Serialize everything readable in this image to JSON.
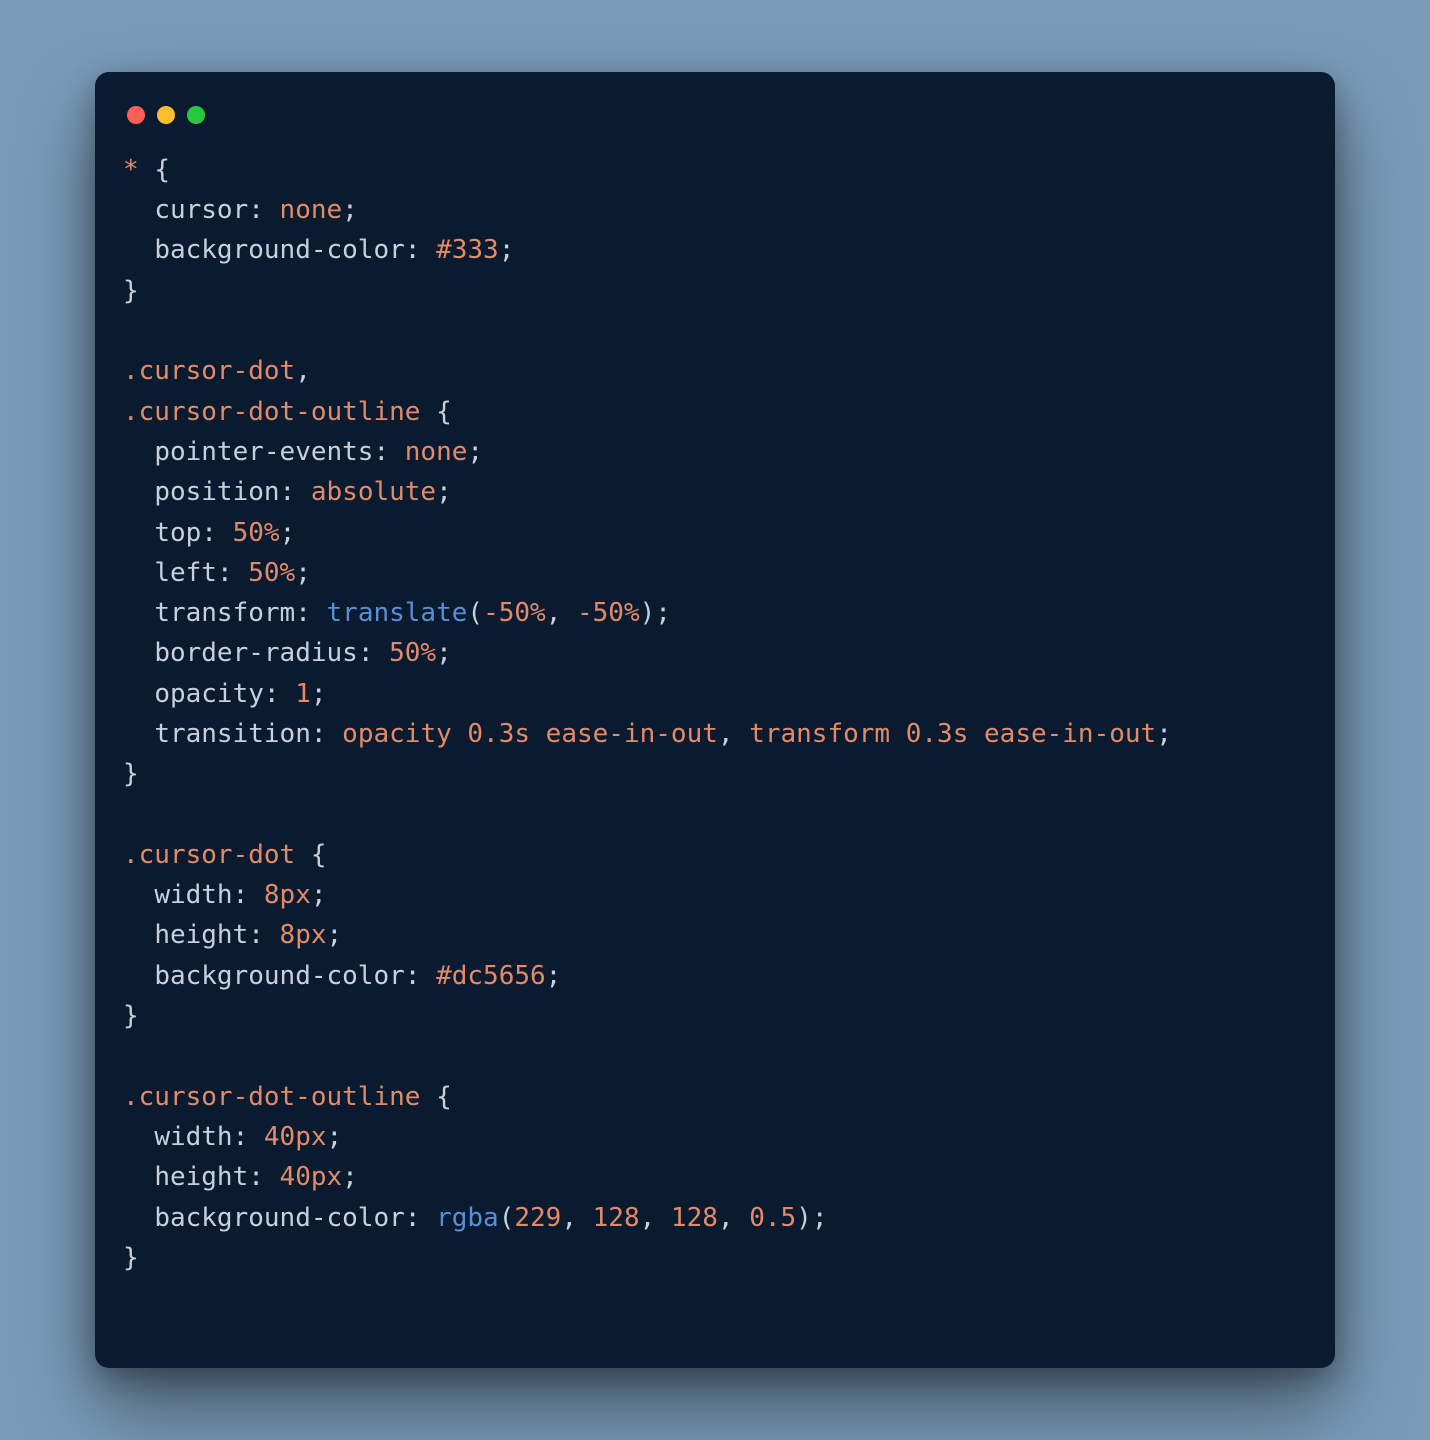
{
  "window": {
    "traffic_lights": {
      "close": "red",
      "minimize": "yellow",
      "zoom": "green"
    }
  },
  "code": {
    "language": "css",
    "tokens": [
      [
        {
          "t": "*",
          "c": "selector"
        },
        {
          "t": " ",
          "c": "default"
        },
        {
          "t": "{",
          "c": "brace"
        }
      ],
      [
        {
          "t": "  ",
          "c": "default"
        },
        {
          "t": "cursor",
          "c": "property"
        },
        {
          "t": ": ",
          "c": "punct"
        },
        {
          "t": "none",
          "c": "value-keyword"
        },
        {
          "t": ";",
          "c": "punct"
        }
      ],
      [
        {
          "t": "  ",
          "c": "default"
        },
        {
          "t": "background-color",
          "c": "property"
        },
        {
          "t": ": ",
          "c": "punct"
        },
        {
          "t": "#333",
          "c": "number"
        },
        {
          "t": ";",
          "c": "punct"
        }
      ],
      [
        {
          "t": "}",
          "c": "brace"
        }
      ],
      [],
      [
        {
          "t": ".cursor-dot",
          "c": "selector"
        },
        {
          "t": ",",
          "c": "punct"
        }
      ],
      [
        {
          "t": ".cursor-dot-outline",
          "c": "selector"
        },
        {
          "t": " ",
          "c": "default"
        },
        {
          "t": "{",
          "c": "brace"
        }
      ],
      [
        {
          "t": "  ",
          "c": "default"
        },
        {
          "t": "pointer-events",
          "c": "property"
        },
        {
          "t": ": ",
          "c": "punct"
        },
        {
          "t": "none",
          "c": "value-keyword"
        },
        {
          "t": ";",
          "c": "punct"
        }
      ],
      [
        {
          "t": "  ",
          "c": "default"
        },
        {
          "t": "position",
          "c": "property"
        },
        {
          "t": ": ",
          "c": "punct"
        },
        {
          "t": "absolute",
          "c": "value-keyword"
        },
        {
          "t": ";",
          "c": "punct"
        }
      ],
      [
        {
          "t": "  ",
          "c": "default"
        },
        {
          "t": "top",
          "c": "property"
        },
        {
          "t": ": ",
          "c": "punct"
        },
        {
          "t": "50%",
          "c": "number"
        },
        {
          "t": ";",
          "c": "punct"
        }
      ],
      [
        {
          "t": "  ",
          "c": "default"
        },
        {
          "t": "left",
          "c": "property"
        },
        {
          "t": ": ",
          "c": "punct"
        },
        {
          "t": "50%",
          "c": "number"
        },
        {
          "t": ";",
          "c": "punct"
        }
      ],
      [
        {
          "t": "  ",
          "c": "default"
        },
        {
          "t": "transform",
          "c": "property"
        },
        {
          "t": ": ",
          "c": "punct"
        },
        {
          "t": "translate",
          "c": "func"
        },
        {
          "t": "(",
          "c": "punct"
        },
        {
          "t": "-50%",
          "c": "number"
        },
        {
          "t": ", ",
          "c": "punct"
        },
        {
          "t": "-50%",
          "c": "number"
        },
        {
          "t": ")",
          "c": "punct"
        },
        {
          "t": ";",
          "c": "punct"
        }
      ],
      [
        {
          "t": "  ",
          "c": "default"
        },
        {
          "t": "border-radius",
          "c": "property"
        },
        {
          "t": ": ",
          "c": "punct"
        },
        {
          "t": "50%",
          "c": "number"
        },
        {
          "t": ";",
          "c": "punct"
        }
      ],
      [
        {
          "t": "  ",
          "c": "default"
        },
        {
          "t": "opacity",
          "c": "property"
        },
        {
          "t": ": ",
          "c": "punct"
        },
        {
          "t": "1",
          "c": "number"
        },
        {
          "t": ";",
          "c": "punct"
        }
      ],
      [
        {
          "t": "  ",
          "c": "default"
        },
        {
          "t": "transition",
          "c": "property"
        },
        {
          "t": ": ",
          "c": "punct"
        },
        {
          "t": "opacity ",
          "c": "value-keyword"
        },
        {
          "t": "0.3s",
          "c": "number"
        },
        {
          "t": " ease-in-out",
          "c": "value-keyword"
        },
        {
          "t": ", ",
          "c": "punct"
        },
        {
          "t": "transform ",
          "c": "value-keyword"
        },
        {
          "t": "0.3s",
          "c": "number"
        },
        {
          "t": " ease-in-out",
          "c": "value-keyword"
        },
        {
          "t": ";",
          "c": "punct"
        }
      ],
      [
        {
          "t": "}",
          "c": "brace"
        }
      ],
      [],
      [
        {
          "t": ".cursor-dot",
          "c": "selector"
        },
        {
          "t": " ",
          "c": "default"
        },
        {
          "t": "{",
          "c": "brace"
        }
      ],
      [
        {
          "t": "  ",
          "c": "default"
        },
        {
          "t": "width",
          "c": "property"
        },
        {
          "t": ": ",
          "c": "punct"
        },
        {
          "t": "8px",
          "c": "number"
        },
        {
          "t": ";",
          "c": "punct"
        }
      ],
      [
        {
          "t": "  ",
          "c": "default"
        },
        {
          "t": "height",
          "c": "property"
        },
        {
          "t": ": ",
          "c": "punct"
        },
        {
          "t": "8px",
          "c": "number"
        },
        {
          "t": ";",
          "c": "punct"
        }
      ],
      [
        {
          "t": "  ",
          "c": "default"
        },
        {
          "t": "background-color",
          "c": "property"
        },
        {
          "t": ": ",
          "c": "punct"
        },
        {
          "t": "#dc5656",
          "c": "number"
        },
        {
          "t": ";",
          "c": "punct"
        }
      ],
      [
        {
          "t": "}",
          "c": "brace"
        }
      ],
      [],
      [
        {
          "t": ".cursor-dot-outline",
          "c": "selector"
        },
        {
          "t": " ",
          "c": "default"
        },
        {
          "t": "{",
          "c": "brace"
        }
      ],
      [
        {
          "t": "  ",
          "c": "default"
        },
        {
          "t": "width",
          "c": "property"
        },
        {
          "t": ": ",
          "c": "punct"
        },
        {
          "t": "40px",
          "c": "number"
        },
        {
          "t": ";",
          "c": "punct"
        }
      ],
      [
        {
          "t": "  ",
          "c": "default"
        },
        {
          "t": "height",
          "c": "property"
        },
        {
          "t": ": ",
          "c": "punct"
        },
        {
          "t": "40px",
          "c": "number"
        },
        {
          "t": ";",
          "c": "punct"
        }
      ],
      [
        {
          "t": "  ",
          "c": "default"
        },
        {
          "t": "background-color",
          "c": "property"
        },
        {
          "t": ": ",
          "c": "punct"
        },
        {
          "t": "rgba",
          "c": "func"
        },
        {
          "t": "(",
          "c": "punct"
        },
        {
          "t": "229",
          "c": "number"
        },
        {
          "t": ", ",
          "c": "punct"
        },
        {
          "t": "128",
          "c": "number"
        },
        {
          "t": ", ",
          "c": "punct"
        },
        {
          "t": "128",
          "c": "number"
        },
        {
          "t": ", ",
          "c": "punct"
        },
        {
          "t": "0.5",
          "c": "number"
        },
        {
          "t": ")",
          "c": "punct"
        },
        {
          "t": ";",
          "c": "punct"
        }
      ],
      [
        {
          "t": "}",
          "c": "brace"
        }
      ]
    ]
  }
}
